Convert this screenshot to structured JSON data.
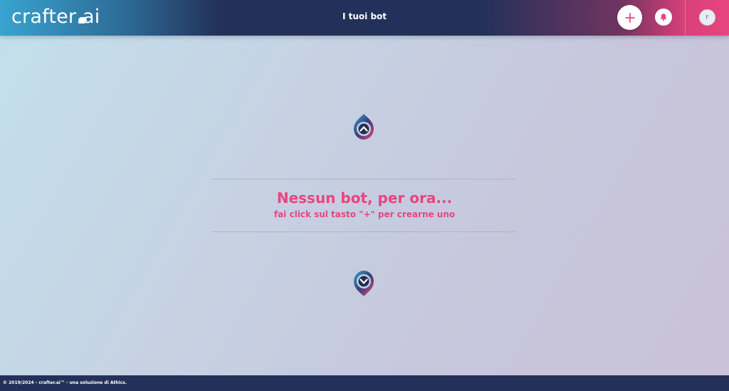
{
  "header": {
    "logo_text": "crafter",
    "logo_suffix": ".ai",
    "title": "I tuoi bot",
    "add_icon": "plus-icon",
    "notifications_icon": "bell-icon",
    "avatar_initial": "F"
  },
  "empty_state": {
    "title": "Nessun bot, per ora...",
    "subtitle": "fai click sul tasto \"+\" per crearne uno",
    "top_icon": "pin-chevron-up-icon",
    "bottom_icon": "pin-chevron-down-icon"
  },
  "footer": {
    "copyright": "© 2019/2024 - crafter.ai™ - una soluzione di Athics."
  },
  "colors": {
    "accent": "#e8457f",
    "navy": "#23315a",
    "cyan": "#39a3cf"
  }
}
